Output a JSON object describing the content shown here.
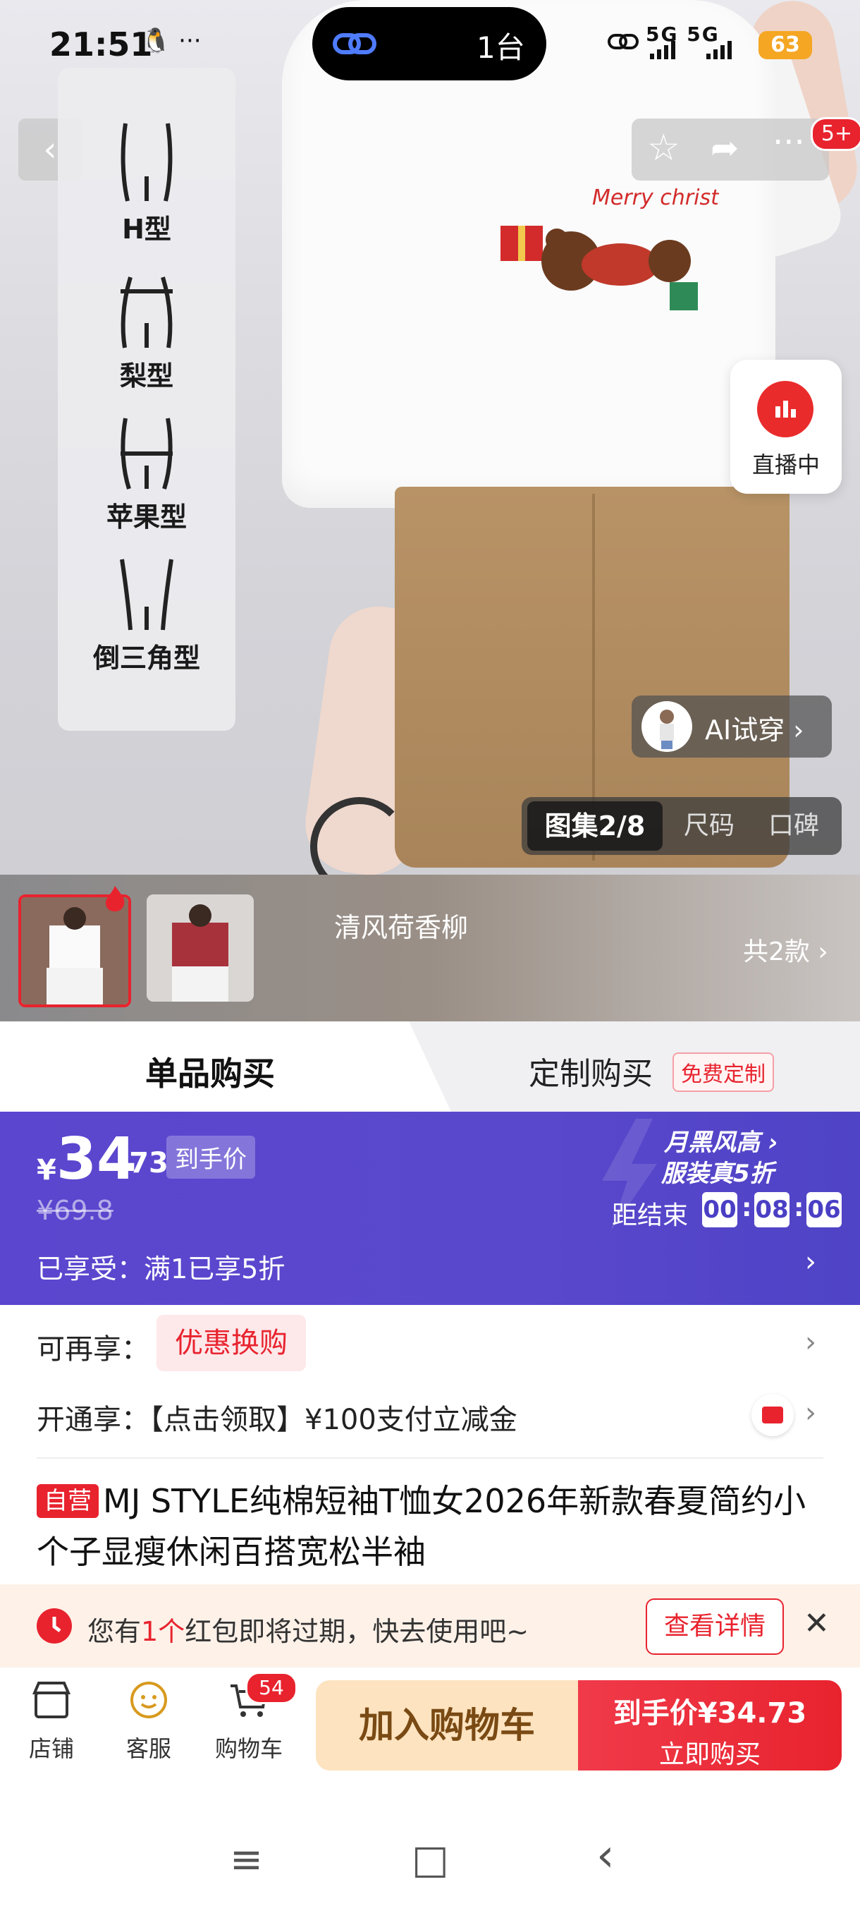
{
  "status_bar": {
    "time": "21:51",
    "icons": "🐧 ···",
    "island_count": "1台",
    "signals": "5G 5G",
    "battery": "63"
  },
  "hero": {
    "badge": "5+",
    "body_shapes": [
      "H型",
      "梨型",
      "苹果型",
      "倒三角型"
    ],
    "print_text": "Merry christmas",
    "live_label": "直播中",
    "ai_try_label": "AI试穿 ›",
    "gallery_tabs": [
      "图集2/8",
      "尺码",
      "口碑"
    ]
  },
  "variants": {
    "name": "清风荷香柳",
    "count": "共2款 ›"
  },
  "mode_tabs": {
    "single": "单品购买",
    "custom": "定制购买",
    "custom_badge": "免费定制"
  },
  "price": {
    "currency": "¥",
    "integer": "34",
    "decimal": ".73",
    "tag": "到手价",
    "original": "¥69.8",
    "enjoyed": "已享受：满1已享5折",
    "promo_line1": "月黑风高 ›",
    "promo_line2": "服装真5折",
    "countdown_label": "距结束",
    "countdown": [
      "00",
      "08",
      "06"
    ]
  },
  "rows": {
    "more_label": "可再享：",
    "more_chip": "优惠换购",
    "open_label": "开通享：【点击领取】¥100支付立减金"
  },
  "product": {
    "self_badge": "自营",
    "title": "MJ STYLE纯棉短袖T恤女2026年新款春夏简约小个子显瘦休闲百搭宽松半袖"
  },
  "notice": {
    "text_pre": "您有",
    "text_hl": "1个",
    "text_post": "红包即将过期，快去使用吧~",
    "button": "查看详情",
    "close": "✕"
  },
  "bottom_bar": {
    "store": "店铺",
    "service": "客服",
    "cart": "购物车",
    "cart_count": "54",
    "add_cart": "加入购物车",
    "buy_l1": "到手价¥34.73",
    "buy_l2": "立即购买"
  },
  "system_nav": [
    "≡",
    "□",
    "‹"
  ],
  "colors": {
    "accent_red": "#e8232e",
    "price_banner": "#5b46cf",
    "cart_button": "#fde3bf"
  }
}
